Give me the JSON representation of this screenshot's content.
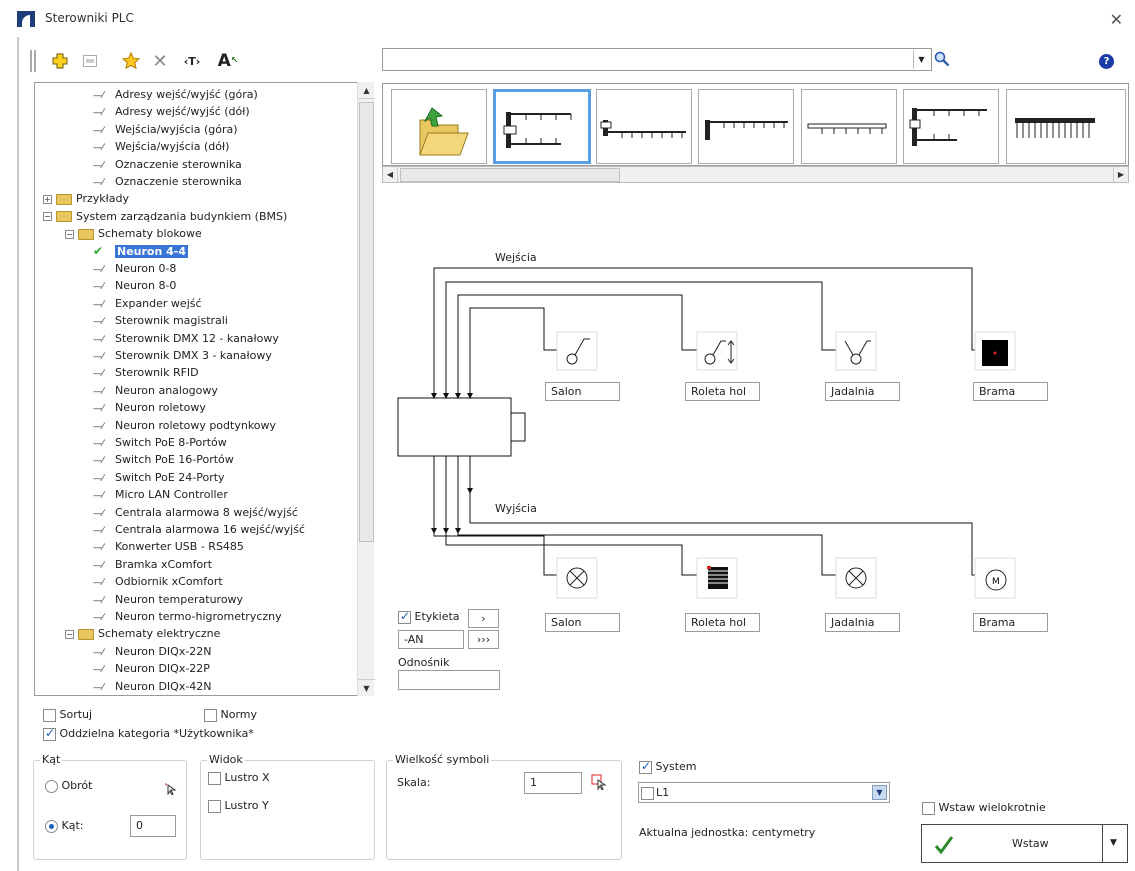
{
  "window": {
    "title": "Sterowniki PLC"
  },
  "tree": {
    "items": [
      {
        "label": "Adresy wejść/wyjść (góra)",
        "level": 2,
        "kind": "leaf"
      },
      {
        "label": "Adresy wejść/wyjść (dół)",
        "level": 2,
        "kind": "leaf"
      },
      {
        "label": "Wejścia/wyjścia (góra)",
        "level": 2,
        "kind": "leaf"
      },
      {
        "label": "Wejścia/wyjścia (dół)",
        "level": 2,
        "kind": "leaf"
      },
      {
        "label": "Oznaczenie sterownika",
        "level": 2,
        "kind": "leaf"
      },
      {
        "label": "Oznaczenie sterownika",
        "level": 2,
        "kind": "leaf"
      },
      {
        "label": "Przykłady",
        "level": 0,
        "kind": "folder",
        "expanded": false
      },
      {
        "label": "System zarządzania budynkiem (BMS)",
        "level": 0,
        "kind": "folder",
        "expanded": true
      },
      {
        "label": "Schematy blokowe",
        "level": 1,
        "kind": "folder",
        "expanded": true
      },
      {
        "label": "Neuron 4-4",
        "level": 2,
        "kind": "leaf",
        "selected": true
      },
      {
        "label": "Neuron 0-8",
        "level": 2,
        "kind": "leaf"
      },
      {
        "label": "Neuron 8-0",
        "level": 2,
        "kind": "leaf"
      },
      {
        "label": "Expander wejść",
        "level": 2,
        "kind": "leaf"
      },
      {
        "label": "Sterownik magistrali",
        "level": 2,
        "kind": "leaf"
      },
      {
        "label": "Sterownik DMX 12 - kanałowy",
        "level": 2,
        "kind": "leaf"
      },
      {
        "label": "Sterownik DMX 3 - kanałowy",
        "level": 2,
        "kind": "leaf"
      },
      {
        "label": "Sterownik RFID",
        "level": 2,
        "kind": "leaf"
      },
      {
        "label": "Neuron analogowy",
        "level": 2,
        "kind": "leaf"
      },
      {
        "label": "Neuron roletowy",
        "level": 2,
        "kind": "leaf"
      },
      {
        "label": "Neuron roletowy podtynkowy",
        "level": 2,
        "kind": "leaf"
      },
      {
        "label": "Switch PoE 8-Portów",
        "level": 2,
        "kind": "leaf"
      },
      {
        "label": "Switch PoE 16-Portów",
        "level": 2,
        "kind": "leaf"
      },
      {
        "label": "Switch PoE 24-Porty",
        "level": 2,
        "kind": "leaf"
      },
      {
        "label": "Micro LAN Controller",
        "level": 2,
        "kind": "leaf"
      },
      {
        "label": "Centrala alarmowa 8 wejść/wyjść",
        "level": 2,
        "kind": "leaf"
      },
      {
        "label": "Centrala alarmowa 16 wejść/wyjść",
        "level": 2,
        "kind": "leaf"
      },
      {
        "label": "Konwerter USB - RS485",
        "level": 2,
        "kind": "leaf"
      },
      {
        "label": "Bramka xComfort",
        "level": 2,
        "kind": "leaf"
      },
      {
        "label": "Odbiornik xComfort",
        "level": 2,
        "kind": "leaf"
      },
      {
        "label": "Neuron temperaturowy",
        "level": 2,
        "kind": "leaf"
      },
      {
        "label": "Neuron termo-higrometryczny",
        "level": 2,
        "kind": "leaf"
      },
      {
        "label": "Schematy elektryczne",
        "level": 1,
        "kind": "folder",
        "expanded": true
      },
      {
        "label": "Neuron DIQx-22N",
        "level": 2,
        "kind": "leaf"
      },
      {
        "label": "Neuron DIQx-22P",
        "level": 2,
        "kind": "leaf"
      },
      {
        "label": "Neuron DIQx-42N",
        "level": 2,
        "kind": "leaf"
      }
    ]
  },
  "options": {
    "sortuj": "Sortuj",
    "normy": "Normy",
    "oddzielna": "Oddzielna kategoria *Użytkownika*"
  },
  "kat": {
    "title": "Kąt",
    "obrot": "Obrót",
    "kat_label": "Kąt:",
    "value": "0"
  },
  "widok": {
    "title": "Widok",
    "lustro_x": "Lustro X",
    "lustro_y": "Lustro Y"
  },
  "wielkosc": {
    "title": "Wielkość symboli",
    "skala_label": "Skala:",
    "skala_value": "1"
  },
  "system": {
    "label": "System",
    "select_value": "L1",
    "unit": "Aktualna jednostka: centymetry"
  },
  "insert": {
    "multi": "Wstaw wielokrotnie",
    "button": "Wstaw"
  },
  "diagram": {
    "inputs_label": "Wejścia",
    "outputs_label": "Wyjścia",
    "top_labels": [
      "Salon",
      "Roleta hol",
      "Jadalnia",
      "Brama"
    ],
    "bottom_labels": [
      "Salon",
      "Roleta hol",
      "Jadalnia",
      "Brama"
    ],
    "etykieta": "Etykieta",
    "etykieta_value": "-AN",
    "odnosnik": "Odnośnik",
    "btn_next": "›",
    "btn_all": "›››"
  }
}
